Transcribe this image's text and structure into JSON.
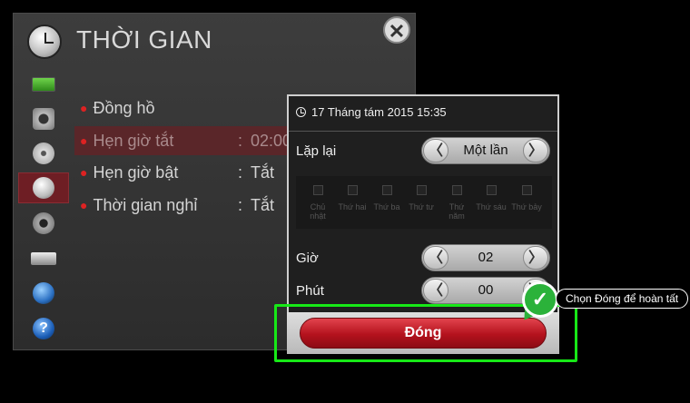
{
  "header": {
    "title": "THỜI GIAN",
    "close_label": "✕"
  },
  "sidebar": {
    "items": [
      {
        "icon": "picture-icon"
      },
      {
        "icon": "speaker-icon"
      },
      {
        "icon": "disc-icon"
      },
      {
        "icon": "clock-icon",
        "active": true
      },
      {
        "icon": "lock-icon"
      },
      {
        "icon": "input-icon"
      },
      {
        "icon": "globe-icon"
      },
      {
        "icon": "help-icon",
        "glyph": "?"
      }
    ]
  },
  "menu": {
    "items": [
      {
        "label": "Đồng hồ",
        "value": ""
      },
      {
        "label": "Hẹn giờ tắt",
        "value": "02:00"
      },
      {
        "label": "Hẹn giờ bật",
        "value": "Tắt"
      },
      {
        "label": "Thời gian nghỉ",
        "value": "Tắt"
      }
    ],
    "separator": ":"
  },
  "dialog": {
    "datetime": "17 Tháng tám 2015  15:35",
    "repeat": {
      "label": "Lặp lại",
      "value": "Một lần"
    },
    "days": [
      "Chủ nhật",
      "Thứ hai",
      "Thứ ba",
      "Thứ tư",
      "Thứ năm",
      "Thứ sáu",
      "Thứ bảy"
    ],
    "hour": {
      "label": "Giờ",
      "value": "02"
    },
    "minute": {
      "label": "Phút",
      "value": "00"
    },
    "close_button": "Đóng",
    "arrow_left": "〈",
    "arrow_right": "〉"
  },
  "annotation": {
    "text": "Chọn Đóng để hoàn tất",
    "check": "✓"
  },
  "colors": {
    "highlight": "#17e817",
    "button_red": "#b4121d",
    "check_green": "#2bb23a"
  }
}
